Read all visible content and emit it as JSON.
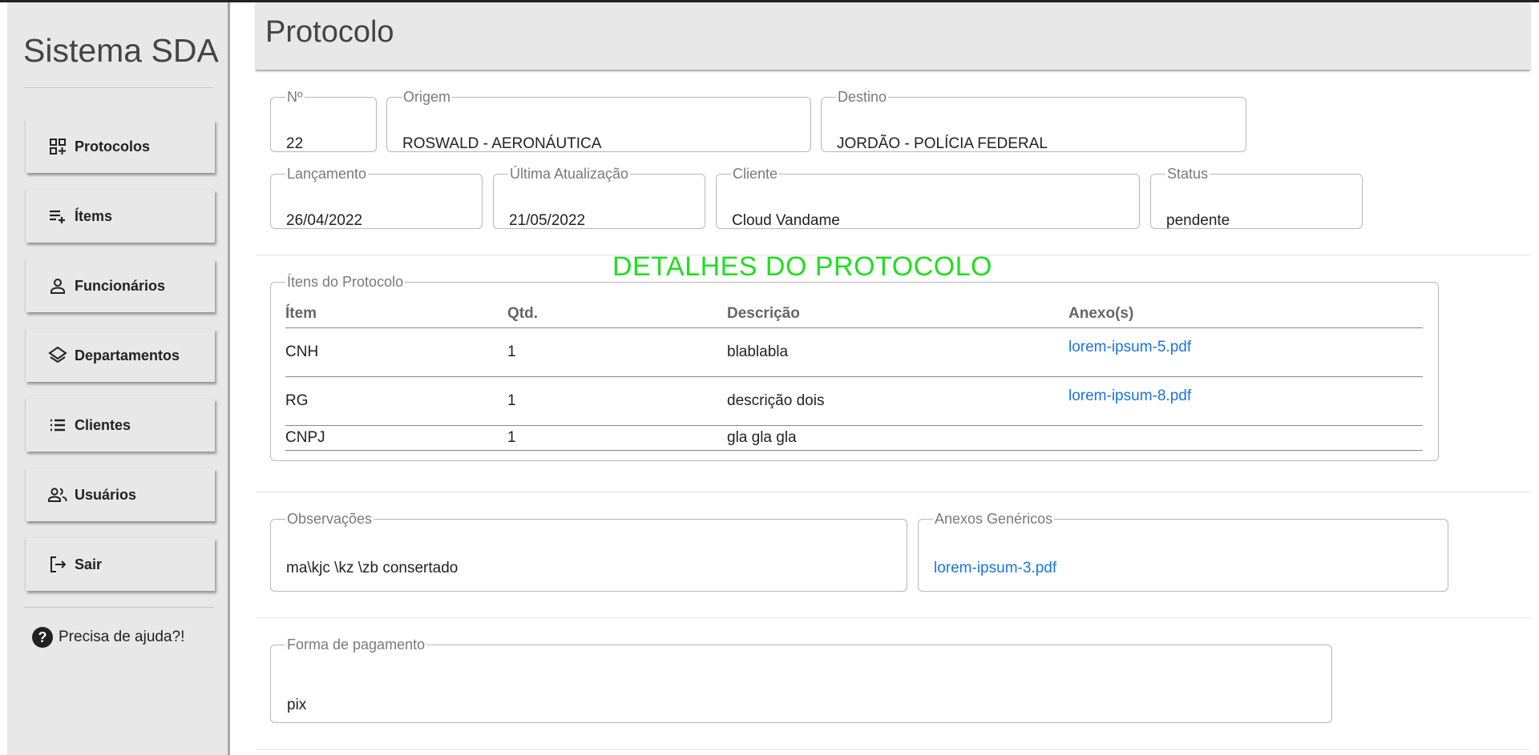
{
  "app": {
    "title": "Sistema SDA"
  },
  "sidebar": {
    "items": [
      {
        "label": "Protocolos",
        "icon": "grid-plus-icon"
      },
      {
        "label": "Ítems",
        "icon": "playlist-add-icon"
      },
      {
        "label": "Funcionários",
        "icon": "person-icon"
      },
      {
        "label": "Departamentos",
        "icon": "layers-icon"
      },
      {
        "label": "Clientes",
        "icon": "list-icon"
      },
      {
        "label": "Usuários",
        "icon": "people-icon"
      },
      {
        "label": "Sair",
        "icon": "logout-icon"
      }
    ],
    "help": {
      "label": "Precisa de ajuda?!",
      "icon": "question-circle-icon"
    }
  },
  "header": {
    "title": "Protocolo"
  },
  "protocol": {
    "numero": {
      "label": "Nº",
      "value": "22"
    },
    "origem": {
      "label": "Origem",
      "value": "ROSWALD - AERONÁUTICA"
    },
    "destino": {
      "label": "Destino",
      "value": "JORDÃO - POLÍCIA FEDERAL"
    },
    "lancamento": {
      "label": "Lançamento",
      "value": "26/04/2022"
    },
    "atualizacao": {
      "label": "Última Atualização",
      "value": "21/05/2022"
    },
    "cliente": {
      "label": "Cliente",
      "value": "Cloud Vandame"
    },
    "status": {
      "label": "Status",
      "value": "pendente"
    }
  },
  "watermark": "DETALHES DO PROTOCOLO",
  "items": {
    "legend": "Ítens do Protocolo",
    "columns": [
      "Ítem",
      "Qtd.",
      "Descrição",
      "Anexo(s)"
    ],
    "rows": [
      {
        "item": "CNH",
        "qtd": "1",
        "descricao": "blablabla",
        "anexo": "lorem-ipsum-5.pdf"
      },
      {
        "item": "RG",
        "qtd": "1",
        "descricao": "descrição dois",
        "anexo": "lorem-ipsum-8.pdf"
      },
      {
        "item": "CNPJ",
        "qtd": "1",
        "descricao": "gla gla gla",
        "anexo": ""
      }
    ]
  },
  "observacoes": {
    "label": "Observações",
    "value": "ma\\kjc \\kz \\zb consertado"
  },
  "anexos_genericos": {
    "label": "Anexos Genéricos",
    "link": "lorem-ipsum-3.pdf"
  },
  "pagamento": {
    "label": "Forma de pagamento",
    "value": "pix"
  },
  "colors": {
    "link": "#1a73e8",
    "watermark": "#22dd22",
    "panel": "#e8e8e8"
  }
}
